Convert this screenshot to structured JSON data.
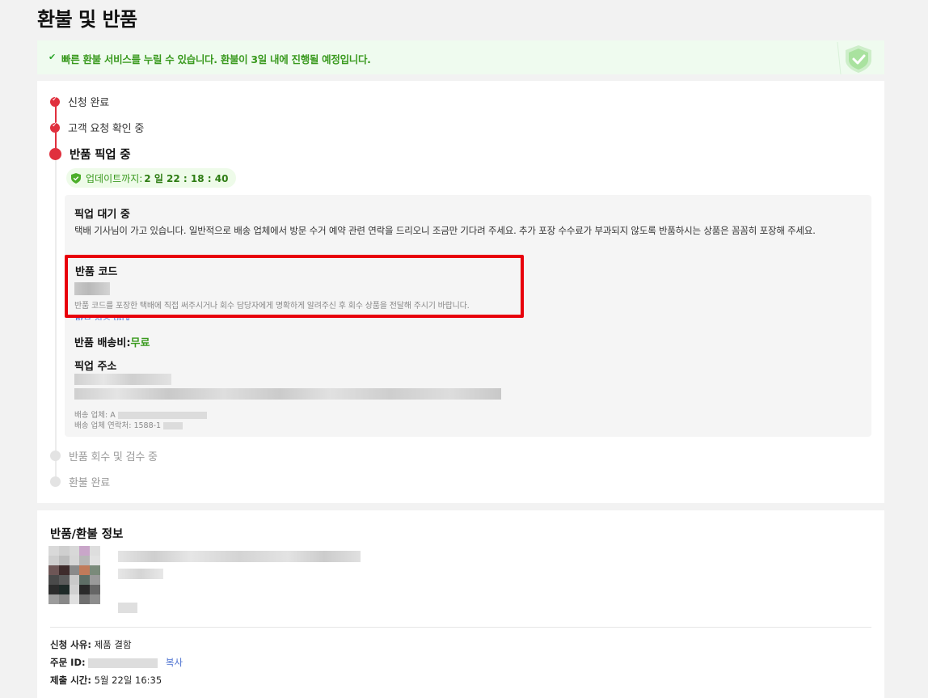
{
  "page": {
    "title": "환불 및 반품"
  },
  "banner": {
    "message": "빠른 환불 서비스를 누릴 수 있습니다. 환불이 3일 내에 진행될 예정입니다.",
    "colors": {
      "background": "#effbef",
      "text": "#3a9a1f"
    }
  },
  "timeline": {
    "steps": [
      {
        "label": "신청 완료",
        "status": "done"
      },
      {
        "label": "고객 요청 확인 중",
        "status": "done"
      },
      {
        "label": "반품 픽업 중",
        "status": "active"
      },
      {
        "label": "반품 회수 및 검수 중",
        "status": "pending"
      },
      {
        "label": "환불 완료",
        "status": "pending"
      }
    ],
    "timer": {
      "label": "업데이트까지:",
      "value": "2 일 22 : 18 : 40"
    },
    "accent_color": "#e0303e"
  },
  "pickup": {
    "status_title": "픽업 대기 중",
    "description": "택배 기사님이 가고 있습니다. 일반적으로 배송 업체에서 방문 수거 예약 관련 연락을 드리오니 조금만 기다려 주세요. 추가 포장 수수료가 부과되지 않도록 반품하시는 상품은 꼼꼼히 포장해 주세요.",
    "return_code_title": "반품 코드",
    "return_code_hint": "반품 코드를 포장한 택배에 직접 써주시거나 회수 담당자에게 명확하게 알려주신 후 회수 상품을 전달해 주시기 바랍니다.",
    "peek_link": "방문 회수 안내",
    "fee_label": "반품 배송비:",
    "fee_value": "무료",
    "address_title": "픽업 주소",
    "carrier_label": "배송 업체: A",
    "carrier_phone_label": "배송 업체 연락처: 1588-1",
    "highlight_color": "#e8000b"
  },
  "info": {
    "title": "반품/환불 정보",
    "reason_label": "신청 사유:",
    "reason_value": "제품 결함",
    "order_id_label": "주문 ID:",
    "copy_label": "복사",
    "submit_time_label": "제출 시간:",
    "submit_time_value": "5월 22일 16:35"
  }
}
